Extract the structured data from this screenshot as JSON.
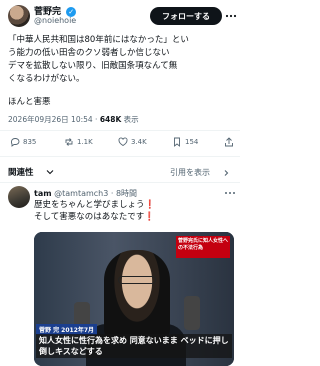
{
  "post": {
    "author_name": "菅野完",
    "verified_badge": "✓",
    "author_handle": "@noiehoie",
    "follow_label": "フォローする",
    "text_lines": [
      "「中華人民共和国は80年前にはなかった」とい",
      "う能力の低い田舎のクソ弱者しか信じない",
      "デマを拡散しない限り、旧敵国条項なんて無",
      "くなるわけがない。"
    ],
    "text_extra": "ほんと害悪",
    "timestamp": "2026年09月26日 10:54 · ",
    "views_count": "648K",
    "views_label": " 表示"
  },
  "actions": {
    "replies": "835",
    "reposts": "1.1K",
    "likes": "3.4K",
    "bookmarks": "154"
  },
  "related": {
    "label": "関連性",
    "sort_label": "引用を表示"
  },
  "reply": {
    "name": "tam",
    "handle_time": "@tamtamch3 · 8時間",
    "line1": "歴史をちゃんと学びましょう❗",
    "line2": "そして害悪なのはあなたです❗",
    "media": {
      "badge": "菅野完氏に知人女性への不法行為",
      "caption_name": "菅野 完 2012年7月",
      "caption_text": "知人女性に性行為を求め 同意ないまま ベッドに押し倒しキスなどする"
    }
  },
  "colors": {
    "accent": "#1d9bf0",
    "text": "#0f1419",
    "muted": "#536471"
  }
}
